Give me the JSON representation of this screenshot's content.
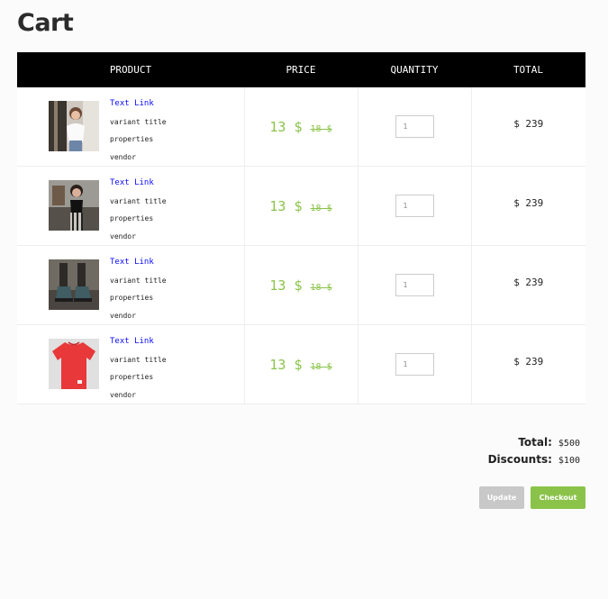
{
  "page": {
    "title": "Cart"
  },
  "table": {
    "headers": {
      "product": "PRODUCT",
      "price": "PRICE",
      "quantity": "QUANTITY",
      "total": "TOTAL"
    },
    "rows": [
      {
        "link": "Text Link",
        "variant": "variant title",
        "properties": "properties",
        "vendor": "vendor",
        "price_current": "13 $",
        "price_old": "18 $",
        "quantity": "1",
        "total": "$ 239",
        "image": "woman-white-top-photo"
      },
      {
        "link": "Text Link",
        "variant": "variant title",
        "properties": "properties",
        "vendor": "vendor",
        "price_current": "13 $",
        "price_old": "18 $",
        "quantity": "1",
        "total": "$ 239",
        "image": "woman-black-top-photo"
      },
      {
        "link": "Text Link",
        "variant": "variant title",
        "properties": "properties",
        "vendor": "vendor",
        "price_current": "13 $",
        "price_old": "18 $",
        "quantity": "1",
        "total": "$ 239",
        "image": "boots-photo"
      },
      {
        "link": "Text Link",
        "variant": "variant title",
        "properties": "properties",
        "vendor": "vendor",
        "price_current": "13 $",
        "price_old": "18 $",
        "quantity": "1",
        "total": "$ 239",
        "image": "red-tshirt-photo"
      }
    ]
  },
  "summary": {
    "total_label": "Total:",
    "total_value": "$500",
    "discounts_label": "Discounts:",
    "discounts_value": "$100"
  },
  "actions": {
    "update_label": "Update",
    "checkout_label": "Checkout"
  },
  "colors": {
    "accent": "#8bc34a",
    "header_bg": "#000000",
    "link": "#0a0aff",
    "update_bg": "#c8c8c8"
  }
}
